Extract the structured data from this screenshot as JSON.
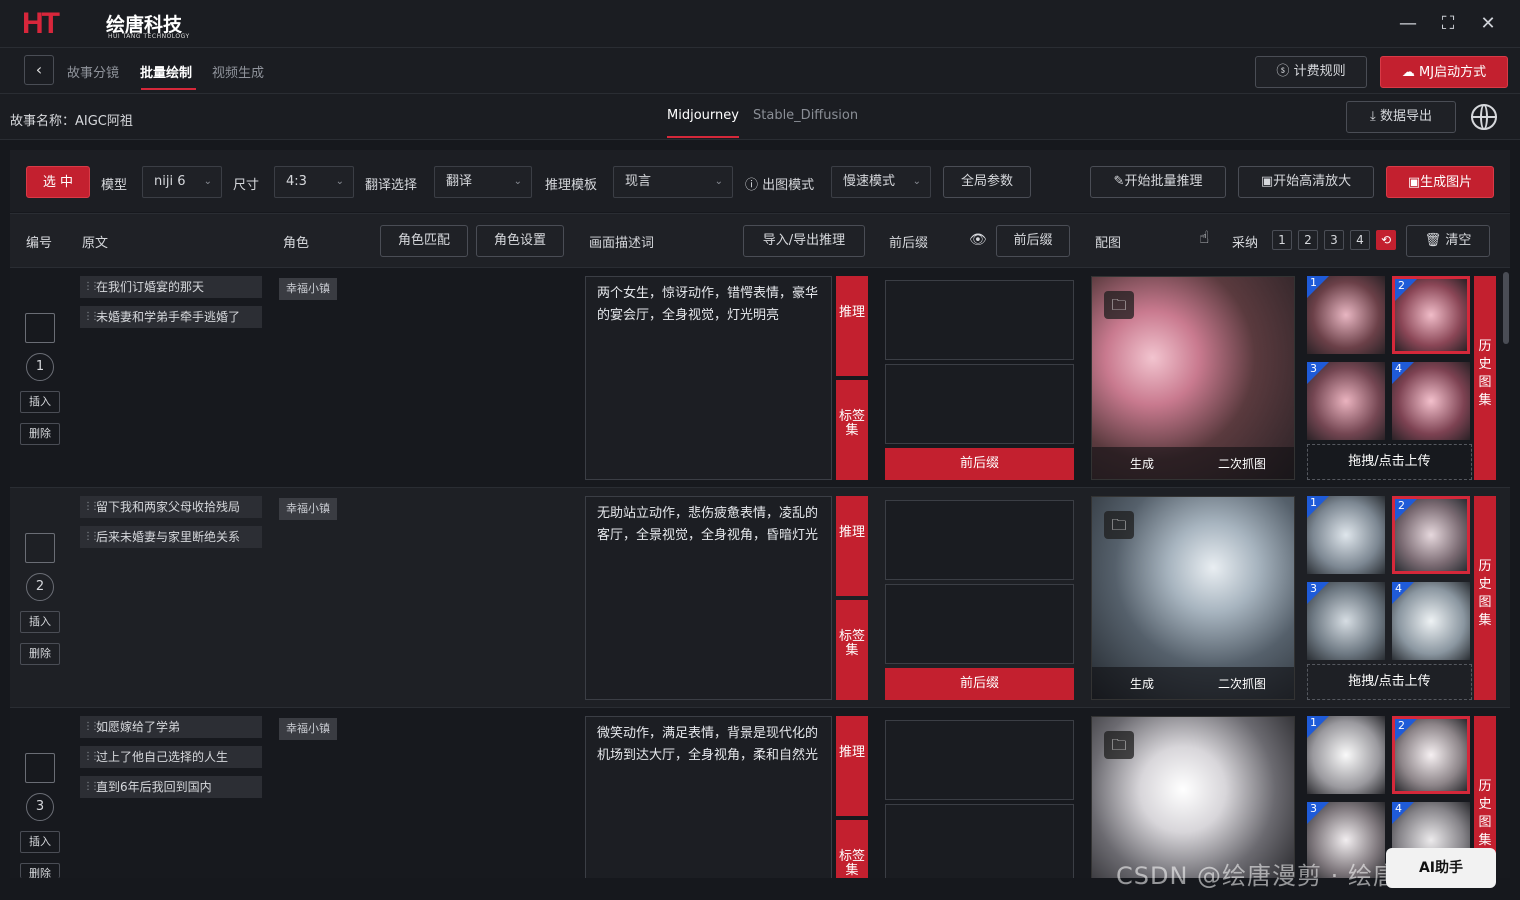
{
  "app": {
    "logo_mark": "HT",
    "logo_name": "绘唐科技",
    "logo_sub": "HUI TANG TECHNOLOGY"
  },
  "nav": {
    "tabs": [
      "故事分镜",
      "批量绘制",
      "视频生成"
    ],
    "billing": "计费规则",
    "mj_start": "MJ启动方式"
  },
  "story": {
    "label": "故事名称：AIGC阿祖",
    "engines": [
      "Midjourney",
      "Stable_Diffusion"
    ],
    "export": "数据导出"
  },
  "toolbar": {
    "select_btn": "选 中",
    "model_label": "模型",
    "model_value": "niji 6",
    "size_label": "尺寸",
    "size_value": "4:3",
    "translate_label": "翻译选择",
    "translate_value": "翻译",
    "template_label": "推理模板",
    "template_value": "现言",
    "mode_label": "出图模式",
    "mode_value": "慢速模式",
    "global_params": "全局参数",
    "batch_infer": "开始批量推理",
    "hd_upscale": "开始高清放大",
    "gen_image": "生成图片"
  },
  "header": {
    "num": "编号",
    "original": "原文",
    "role": "角色",
    "role_match": "角色匹配",
    "role_settings": "角色设置",
    "desc": "画面描述词",
    "import_export": "导入/导出推理",
    "prefix": "前后缀",
    "prefix_btn": "前后缀",
    "image": "配图",
    "adopt": "采纳",
    "pages": [
      "1",
      "2",
      "3",
      "4"
    ],
    "clear": "清空"
  },
  "labels": {
    "insert": "插入",
    "delete": "删除",
    "infer": "推理",
    "tags": "标签集",
    "prefix_btn": "前后缀",
    "generate": "生成",
    "second_capture": "二次抓图",
    "upload": "拖拽/点击上传",
    "history": "历史图集"
  },
  "rows": [
    {
      "num": "1",
      "sentences": [
        "在我们订婚宴的那天",
        "未婚妻和学弟手牵手逃婚了"
      ],
      "role": "幸福小镇",
      "desc": "两个女生，惊讶动作，错愕表情，豪华的宴会厅，全身视觉，灯光明亮"
    },
    {
      "num": "2",
      "sentences": [
        "留下我和两家父母收拾残局",
        "后来未婚妻与家里断绝关系"
      ],
      "role": "幸福小镇",
      "desc": "无助站立动作，悲伤疲惫表情，凌乱的客厅，全景视觉，全身视角，昏暗灯光"
    },
    {
      "num": "3",
      "sentences": [
        "如愿嫁给了学弟",
        "过上了他自己选择的人生",
        "直到6年后我回到国内"
      ],
      "role": "幸福小镇",
      "desc": "微笑动作，满足表情，背景是现代化的机场到达大厅，全身视角，柔和自然光"
    }
  ],
  "watermark": "CSDN @绘唐漫剪 · 绘唐SAIGC",
  "ai_badge": "AI助手",
  "colors": {
    "accent": "#c3202f",
    "bg": "#16181d",
    "badge_blue": "#1f5bd8"
  }
}
